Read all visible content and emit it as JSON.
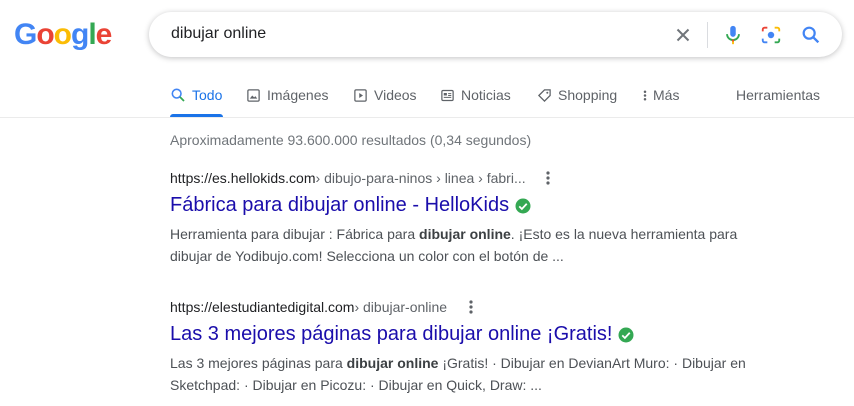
{
  "logo": {
    "letters": [
      "G",
      "o",
      "o",
      "g",
      "l",
      "e"
    ],
    "colors": [
      "#4285F4",
      "#EA4335",
      "#FBBC05",
      "#4285F4",
      "#34A853",
      "#EA4335"
    ]
  },
  "search": {
    "query": "dibujar online"
  },
  "tabs": [
    {
      "label": "Todo",
      "icon": "search-icon"
    },
    {
      "label": "Imágenes",
      "icon": "image-icon"
    },
    {
      "label": "Videos",
      "icon": "video-icon"
    },
    {
      "label": "Noticias",
      "icon": "news-icon"
    },
    {
      "label": "Shopping",
      "icon": "tag-icon"
    },
    {
      "label": "Más",
      "icon": "more-vert-icon"
    }
  ],
  "tools_label": "Herramientas",
  "stats": "Aproximadamente 93.600.000 resultados (0,34 segundos)",
  "results": [
    {
      "domain": "https://es.hellokids.com",
      "crumbs": " › dibujo-para-ninos › linea › fabri...",
      "title": "Fábrica para dibujar online - HelloKids",
      "snippet_pre": "Herramienta para dibujar : Fábrica para ",
      "snippet_bold": "dibujar online",
      "snippet_post": ". ¡Esto es la nueva herramienta para dibujar de Yodibujo.com! Selecciona un color con el botón de ..."
    },
    {
      "domain": "https://elestudiantedigital.com",
      "crumbs": " › dibujar-online",
      "title": "Las 3 mejores páginas para dibujar online ¡Gratis!",
      "snippet_pre": "Las 3 mejores páginas para ",
      "snippet_bold": "dibujar online",
      "snippet_post": " ¡Gratis! · Dibujar en DevianArt Muro: · Dibujar en Sketchpad: · Dibujar en Picozu: · Dibujar en Quick, Draw: ..."
    }
  ],
  "colors": {
    "link": "#1a0dab",
    "accent": "#1a73e8",
    "verified": "#34a853"
  }
}
